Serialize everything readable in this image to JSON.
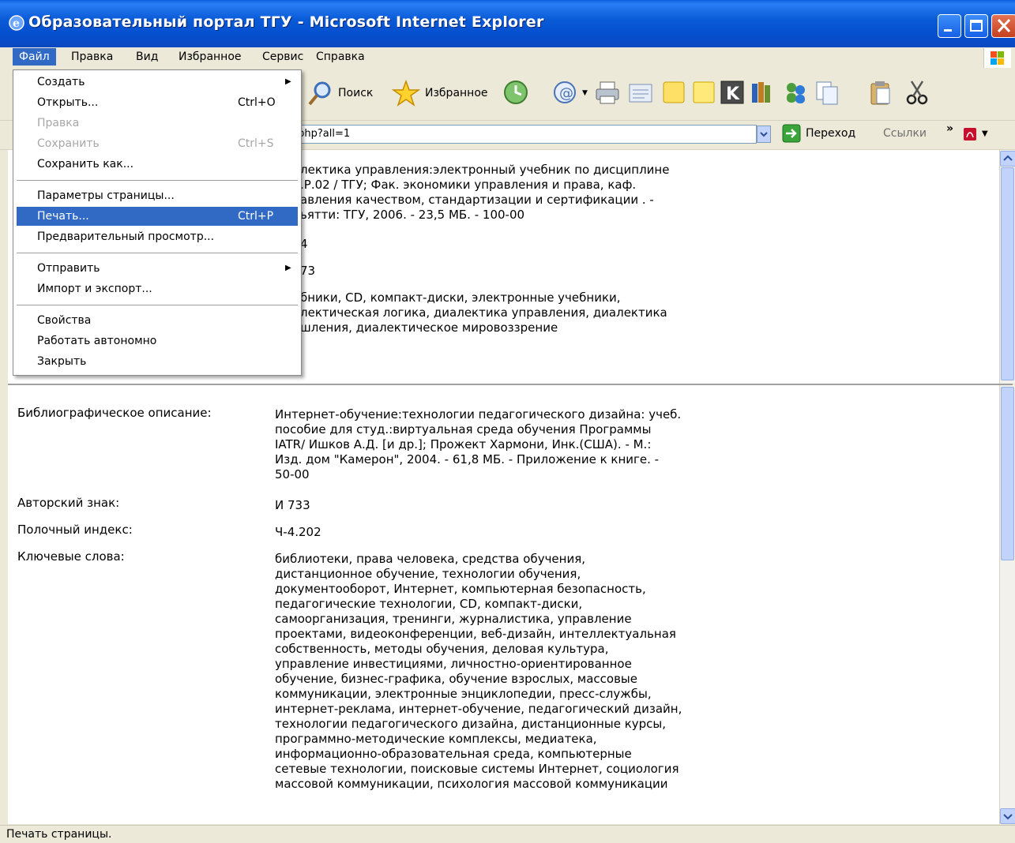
{
  "window": {
    "title": "Образовательный портал ТГУ - Microsoft Internet Explorer"
  },
  "menubar": [
    "Файл",
    "Правка",
    "Вид",
    "Избранное",
    "Сервис",
    "Справка"
  ],
  "toolbar": {
    "search": "Поиск",
    "favorites": "Избранное"
  },
  "address": {
    "value": ".php?all=1",
    "go": "Переход",
    "links": "Ссылки",
    "chevron": "»"
  },
  "file_menu": {
    "items": [
      {
        "label": "Создать",
        "shortcut": "",
        "submenu": true,
        "disabled": false
      },
      {
        "label": "Открыть...",
        "shortcut": "Ctrl+O",
        "submenu": false,
        "disabled": false
      },
      {
        "label": "Правка",
        "shortcut": "",
        "submenu": false,
        "disabled": true
      },
      {
        "label": "Сохранить",
        "shortcut": "Ctrl+S",
        "submenu": false,
        "disabled": true
      },
      {
        "label": "Сохранить как...",
        "shortcut": "",
        "submenu": false,
        "disabled": false
      },
      {
        "label": "Параметры страницы...",
        "shortcut": "",
        "submenu": false,
        "disabled": false
      },
      {
        "label": "Печать...",
        "shortcut": "Ctrl+P",
        "submenu": false,
        "disabled": false,
        "highlighted": true
      },
      {
        "label": "Предварительный просмотр...",
        "shortcut": "",
        "submenu": false,
        "disabled": false
      },
      {
        "label": "Отправить",
        "shortcut": "",
        "submenu": true,
        "disabled": false
      },
      {
        "label": "Импорт и экспорт...",
        "shortcut": "",
        "submenu": false,
        "disabled": false
      },
      {
        "label": "Свойства",
        "shortcut": "",
        "submenu": false,
        "disabled": false
      },
      {
        "label": "Работать автономно",
        "shortcut": "",
        "submenu": false,
        "disabled": false
      },
      {
        "label": "Закрыть",
        "shortcut": "",
        "submenu": false,
        "disabled": false
      }
    ]
  },
  "top_record": {
    "desc_lines": [
      "лектика управления:электронный учебник по дисциплине",
      ".Р.02 / ТГУ; Фак. экономики управления и права, каф.",
      "авления качеством, стандартизации и сертификации . -",
      "ьятти: ТГУ, 2006. - 23,5 МБ. - 100-00"
    ],
    "author_sign_partial": "4",
    "shelf_index_partial": "73",
    "keywords_lines": [
      "бники, CD, компакт-диски, электронные учебники,",
      "лектическая логика, диалектика управления, диалектика",
      "шления, диалектическое мировоззрение"
    ]
  },
  "record": {
    "labels": {
      "description": "Библиографическое описание:",
      "author_sign": "Авторский знак:",
      "shelf_index": "Полочный индекс:",
      "keywords": "Ключевые слова:"
    },
    "description_lines": [
      "Интернет-обучение:технологии педагогического дизайна: учеб.",
      "пособие для студ.:виртуальная среда обучения Программы",
      "IATR/ Ишков А.Д. [и др.]; Прожект Хармони, Инк.(США). - М.:",
      "Изд. дом \"Камерон\", 2004. - 61,8 МБ. - Приложение к книге. -",
      "50-00"
    ],
    "author_sign": "И 733",
    "shelf_index": "Ч-4.202",
    "keywords_lines": [
      "библиотеки, права человека, средства обучения,",
      "дистанционное обучение, технологии обучения,",
      "документооборот, Интернет, компьютерная безопасность,",
      "педагогические технологии, CD, компакт-диски,",
      "самоорганизация, тренинги, журналистика, управление",
      "проектами, видеоконференции, веб-дизайн, интеллектуальная",
      "собственность, методы обучения, деловая культура,",
      "управление инвестициями, личностно-ориентированное",
      "обучение, бизнес-графика, обучение взрослых, массовые",
      "коммуникации, электронные энциклопедии, пресс-службы,",
      "интернет-реклама, интернет-обучение, педагогический дизайн,",
      "технологии педагогического дизайна, дистанционные курсы,",
      "программно-методические комплексы, медиатека,",
      "информационно-образовательная среда, компьютерные",
      "сетевые технологии, поисковые системы Интернет, социология",
      "массовой коммуникации, психология массовой коммуникации"
    ]
  },
  "statusbar": {
    "text": "Печать страницы."
  }
}
